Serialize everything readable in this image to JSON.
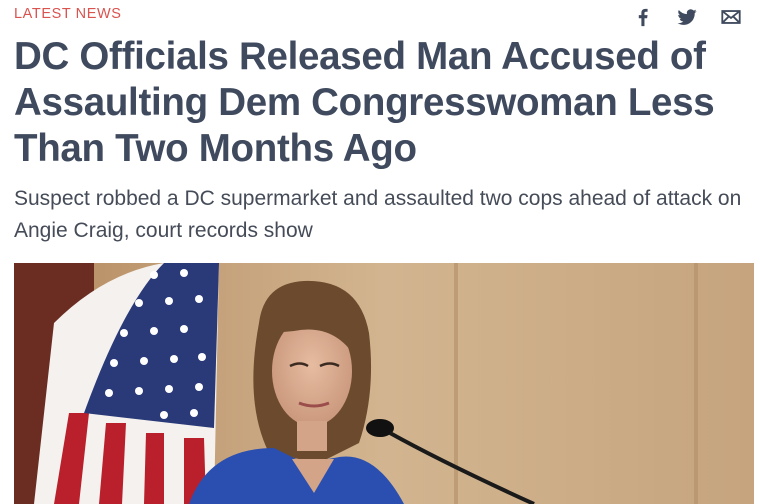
{
  "article": {
    "category": "LATEST NEWS",
    "headline": "DC Officials Released Man Accused of Assaulting Dem Congresswoman Less Than Two Months Ago",
    "subheadline": "Suspect robbed a DC supermarket and assaulted two cops ahead of attack on Angie Craig, court records show",
    "share_icons": [
      "facebook-icon",
      "twitter-icon",
      "email-icon"
    ],
    "hero_image": "photo of a woman with brown hair in a blue blazer speaking at a microphone in front of an American flag"
  },
  "colors": {
    "category": "#d9534f",
    "headline": "#3f4a5e",
    "subhead": "#454c58",
    "icons": "#3f4a5e"
  }
}
